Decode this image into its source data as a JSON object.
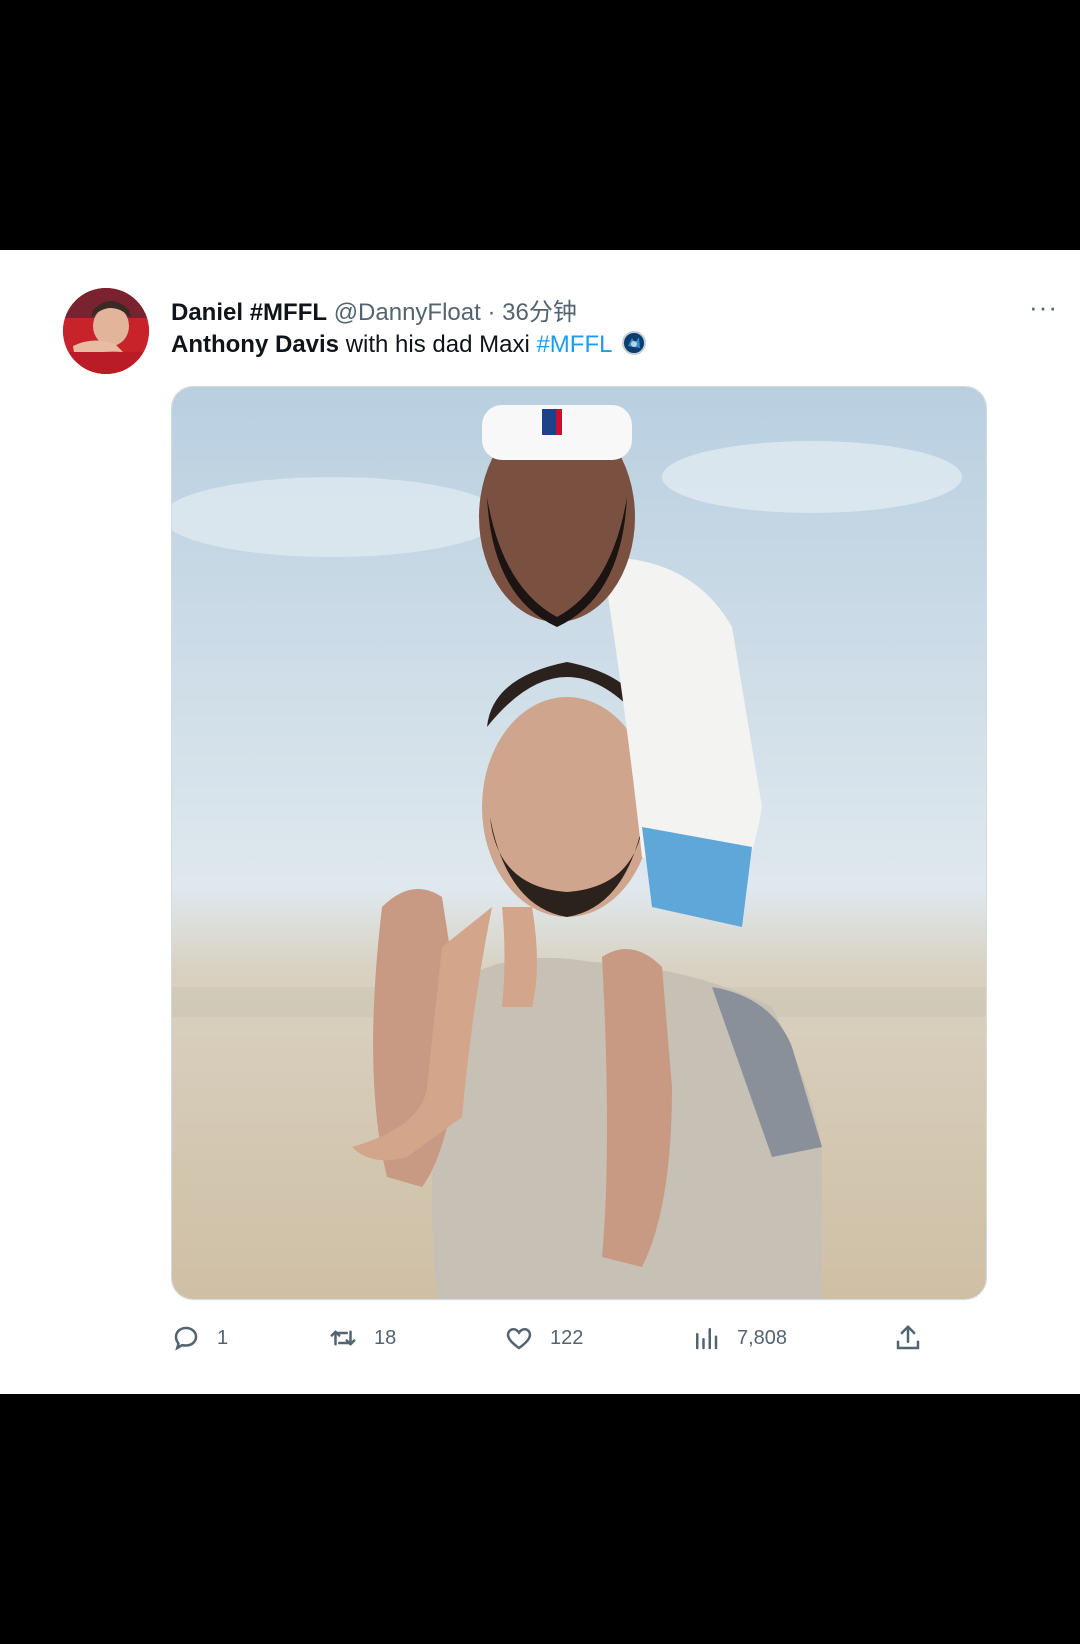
{
  "tweet": {
    "display_name": "Daniel #MFFL",
    "handle": "@DannyFloat",
    "separator": "·",
    "time": "36分钟",
    "more_label": "···",
    "text": {
      "bold_part": "Anthony Davis",
      "plain_part": " with his dad Maxi ",
      "hashtag": "#MFFL"
    },
    "media_description": "photo",
    "stats": {
      "replies": "1",
      "retweets": "18",
      "likes": "122",
      "views": "7,808"
    }
  },
  "colors": {
    "background": "#000000",
    "card": "#ffffff",
    "text_primary": "#0f1419",
    "text_secondary": "#536471",
    "link": "#1d9bf0"
  },
  "icons": {
    "reply": "reply-icon",
    "retweet": "retweet-icon",
    "like": "heart-icon",
    "views": "views-icon",
    "share": "share-icon",
    "more": "more-icon",
    "team": "mavericks-logo-icon"
  }
}
